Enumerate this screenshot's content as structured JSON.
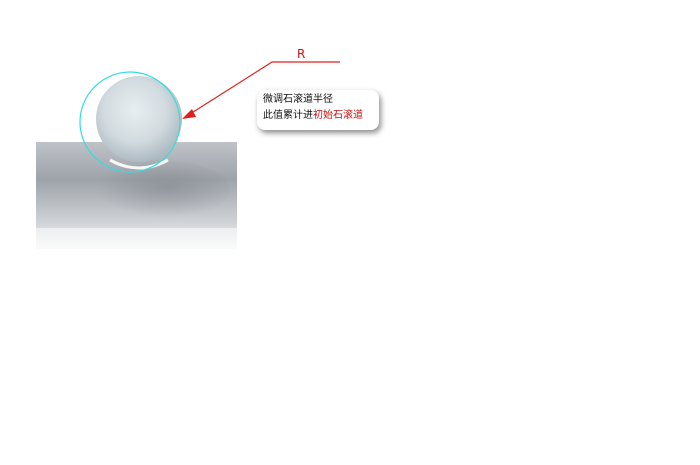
{
  "labels": {
    "radius": "R"
  },
  "callout": {
    "line1": "微调石滚道半径",
    "line2_prefix": "此值累计进",
    "line2_highlight": "初始石滚道"
  },
  "colors": {
    "annotation_red": "#e02020",
    "circle_outline": "#33dddd",
    "ball_fill": "#d7e0e4",
    "surface_gray": "#a8adb4",
    "text_black": "#111111",
    "text_red": "#cc1111"
  }
}
